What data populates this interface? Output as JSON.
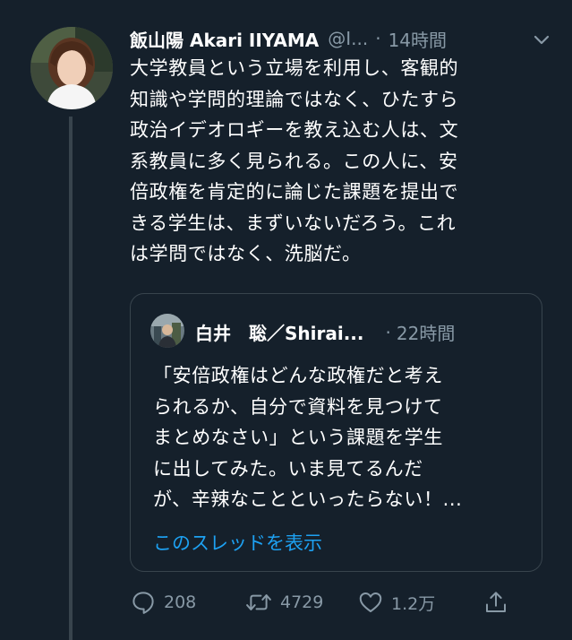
{
  "tweet": {
    "author": {
      "display_name": "飯山陽 Akari IIYAMA",
      "handle": "@I...",
      "avatar_icon": "profile-photo-icon"
    },
    "separator": "·",
    "time": "14時間",
    "text": "大学教員という立場を利用し、客観的\n知識や学問的理論ではなく、ひたすら\n政治イデオロギーを教え込む人は、文\n系教員に多く見られる。この人に、安\n倍政権を肯定的に論じた課題を提出で\nきる学生は、まずいないだろう。これ\nは学問ではなく、洗脳だ。",
    "more_icon": "chevron-down-icon"
  },
  "quoted_tweet": {
    "author": {
      "display_name": "白井　聡／Shirai...",
      "avatar_icon": "profile-photo-icon"
    },
    "separator": "·",
    "time": "22時間",
    "text": "「安倍政権はどんな政権だと考え\nられるか、自分で資料を見つけて\nまとめなさい」という課題を学生\nに出してみた。いま見てるんだ\nが、辛辣なことといったらない！...",
    "thread_link": "このスレッドを表示"
  },
  "actions": {
    "reply_count": "208",
    "retweet_count": "4729",
    "like_count": "1.2万"
  },
  "colors": {
    "background": "#15202b",
    "text_primary": "#ffffff",
    "text_secondary": "#8899a6",
    "link": "#1da1f2",
    "border": "#38444d"
  }
}
